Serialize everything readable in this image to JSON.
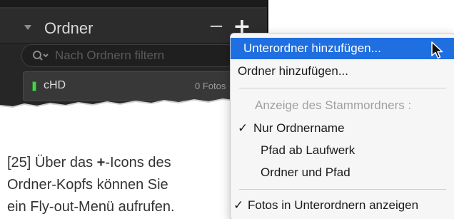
{
  "panel": {
    "title": "Ordner",
    "minus_label": "−",
    "plus_label": "+",
    "search": {
      "placeholder": "Nach Ordnern filtern",
      "value": ""
    },
    "folders": [
      {
        "name": "cHD",
        "count": "0 Fotos"
      }
    ],
    "indicator_color": "#4cd04c"
  },
  "menu": {
    "items": [
      {
        "label": "Unterordner hinzufügen...",
        "state": "highlighted"
      },
      {
        "label": "Ordner hinzufügen...",
        "state": "normal"
      },
      {
        "label": "Anzeige des Stammordners :",
        "state": "disabled"
      },
      {
        "label": "Nur Ordnername",
        "state": "checked"
      },
      {
        "label": "Pfad ab Laufwerk",
        "state": "normal"
      },
      {
        "label": "Ordner und Pfad",
        "state": "normal"
      },
      {
        "label": "Fotos in Unterordnern anzeigen",
        "state": "checked"
      }
    ],
    "check_mark": "✓",
    "highlight_color": "#1f6fe0"
  },
  "caption": {
    "line1_prefix": "[25]  Über das ",
    "line1_bold": "+",
    "line1_suffix": "-Icons des",
    "line2": "Ordner-Kopfs können Sie",
    "line3": "ein Fly-out-Menü aufrufen."
  }
}
